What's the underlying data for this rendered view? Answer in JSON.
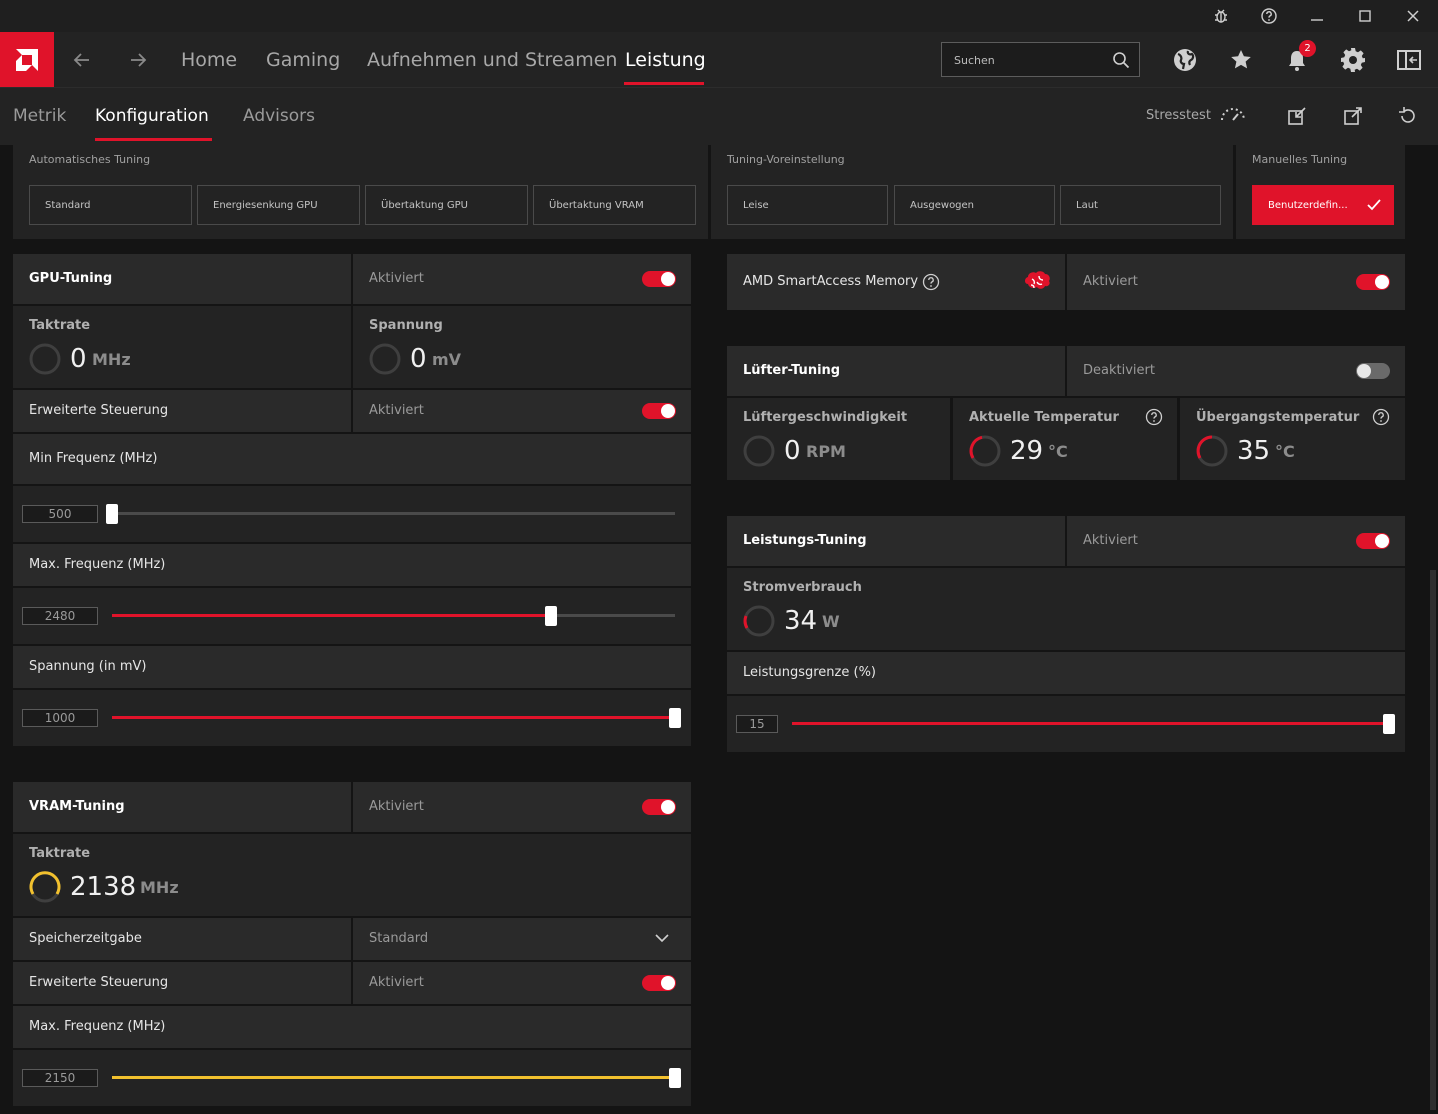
{
  "nav": {
    "tabs": [
      "Home",
      "Gaming",
      "Aufnehmen und Streamen",
      "Leistung"
    ],
    "active_tab": "Leistung",
    "search_placeholder": "Suchen",
    "notification_count": "2"
  },
  "subnav": {
    "tabs": [
      "Metrik",
      "Konfiguration",
      "Advisors"
    ],
    "active_tab": "Konfiguration",
    "stress_label": "Stresstest"
  },
  "presets": {
    "auto_title": "Automatisches Tuning",
    "auto_buttons": [
      "Standard",
      "Energiesenkung GPU",
      "Übertaktung GPU",
      "Übertaktung VRAM"
    ],
    "tuning_title": "Tuning-Voreinstellung",
    "tuning_buttons": [
      "Leise",
      "Ausgewogen",
      "Laut"
    ],
    "manual_title": "Manuelles Tuning",
    "manual_button": "Benutzerdefin..."
  },
  "gpu": {
    "title": "GPU-Tuning",
    "state": "Aktiviert",
    "enabled": true,
    "clock_label": "Taktrate",
    "clock_value": "0",
    "clock_unit": "MHz",
    "voltage_label": "Spannung",
    "voltage_value": "0",
    "voltage_unit": "mV",
    "advanced_label": "Erweiterte Steuerung",
    "advanced_state": "Aktiviert",
    "min_freq_label": "Min Frequenz (MHz)",
    "min_freq_value": "500",
    "min_freq_fraction": 0.0,
    "max_freq_label": "Max. Frequenz (MHz)",
    "max_freq_value": "2480",
    "max_freq_fraction": 0.78,
    "voltage_slider_label": "Spannung (in mV)",
    "voltage_slider_value": "1000",
    "voltage_slider_fraction": 1.0
  },
  "vram": {
    "title": "VRAM-Tuning",
    "state": "Aktiviert",
    "clock_label": "Taktrate",
    "clock_value": "2138",
    "clock_unit": "MHz",
    "timing_label": "Speicherzeitgabe",
    "timing_value": "Standard",
    "advanced_label": "Erweiterte Steuerung",
    "advanced_state": "Aktiviert",
    "max_freq_label": "Max. Frequenz (MHz)",
    "max_freq_value": "2150",
    "max_freq_fraction": 1.0
  },
  "sam": {
    "label": "AMD SmartAccess Memory",
    "state": "Aktiviert"
  },
  "fan": {
    "title": "Lüfter-Tuning",
    "state": "Deaktiviert",
    "speed_label": "Lüftergeschwindigkeit",
    "speed_value": "0",
    "speed_unit": "RPM",
    "temp_label": "Aktuelle Temperatur",
    "temp_value": "29",
    "temp_unit": "°C",
    "junction_label": "Übergangstemperatur",
    "junction_value": "35",
    "junction_unit": "°C"
  },
  "power": {
    "title": "Leistungs-Tuning",
    "state": "Aktiviert",
    "consumption_label": "Stromverbrauch",
    "consumption_value": "34",
    "consumption_unit": "W",
    "limit_label": "Leistungsgrenze (%)",
    "limit_value": "15",
    "limit_fraction": 1.0
  },
  "colors": {
    "accent": "#e0132a",
    "vram_accent": "#f2c12e",
    "panel": "#232323",
    "background": "#141414"
  }
}
